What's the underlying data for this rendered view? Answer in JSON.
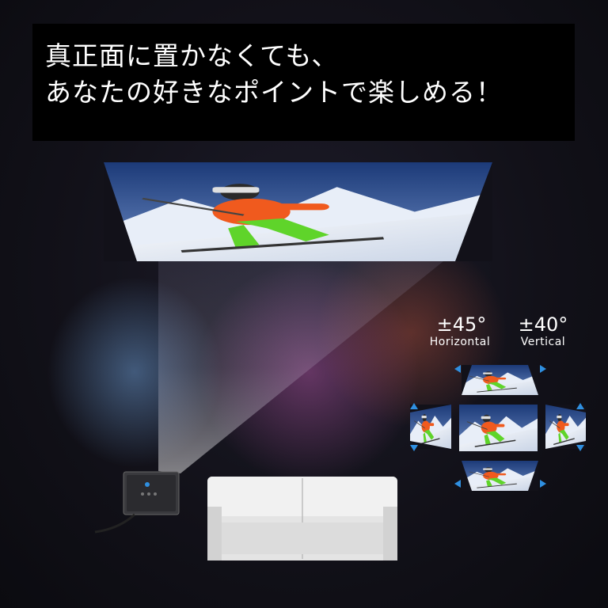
{
  "headline": {
    "line1": "真正面に置かなくても、",
    "line2": "あなたの好きなポイントで楽しめる！"
  },
  "angles": {
    "horizontal_value": "±45°",
    "horizontal_label": "Horizontal",
    "vertical_value": "±40°",
    "vertical_label": "Vertical"
  },
  "colors": {
    "background": "#121119",
    "arrow_blue": "#2f8fe0",
    "jacket_orange": "#f05a1e",
    "pants_green": "#5fd42a",
    "sofa": "#d8d8d8"
  }
}
